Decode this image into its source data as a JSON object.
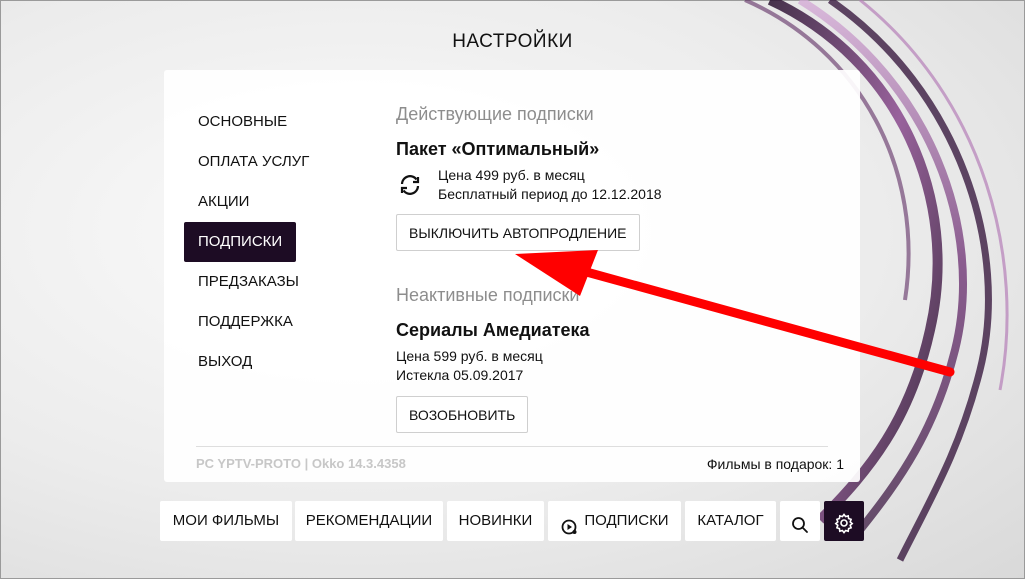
{
  "page": {
    "title": "НАСТРОЙКИ"
  },
  "menu": {
    "items": [
      {
        "label": "ОСНОВНЫЕ"
      },
      {
        "label": "ОПЛАТА УСЛУГ"
      },
      {
        "label": "АКЦИИ"
      },
      {
        "label": "ПОДПИСКИ",
        "active": true
      },
      {
        "label": "ПРЕДЗАКАЗЫ"
      },
      {
        "label": "ПОДДЕРЖКА"
      },
      {
        "label": "ВЫХОД"
      }
    ]
  },
  "active_subs": {
    "title": "Действующие подписки",
    "name": "Пакет «Оптимальный»",
    "price": "Цена 499 руб. в месяц",
    "trial": "Бесплатный период до 12.12.2018",
    "button": "ВЫКЛЮЧИТЬ АВТОПРОДЛЕНИЕ",
    "icon": "refresh-icon"
  },
  "inactive_subs": {
    "title": "Неактивные подписки",
    "name": "Сериалы Амедиатека",
    "price": "Цена 599 руб. в месяц",
    "expired": "Истекла 05.09.2017",
    "button": "ВОЗОБНОВИТЬ"
  },
  "footer": {
    "version": "PC YPTV-PROTO | Okko 14.3.4358",
    "gift": "Фильмы в подарок: 1"
  },
  "bottom_nav": {
    "my_movies": "МОИ ФИЛЬМЫ",
    "recommendations": "РЕКОМЕНДАЦИИ",
    "new": "НОВИНКИ",
    "subscriptions": "ПОДПИСКИ",
    "catalog": "КАТАЛОГ",
    "search_icon": "search-icon",
    "settings_icon": "gear-icon"
  },
  "colors": {
    "accent_dark": "#1d0c24",
    "annotation_arrow": "#ff0000"
  }
}
